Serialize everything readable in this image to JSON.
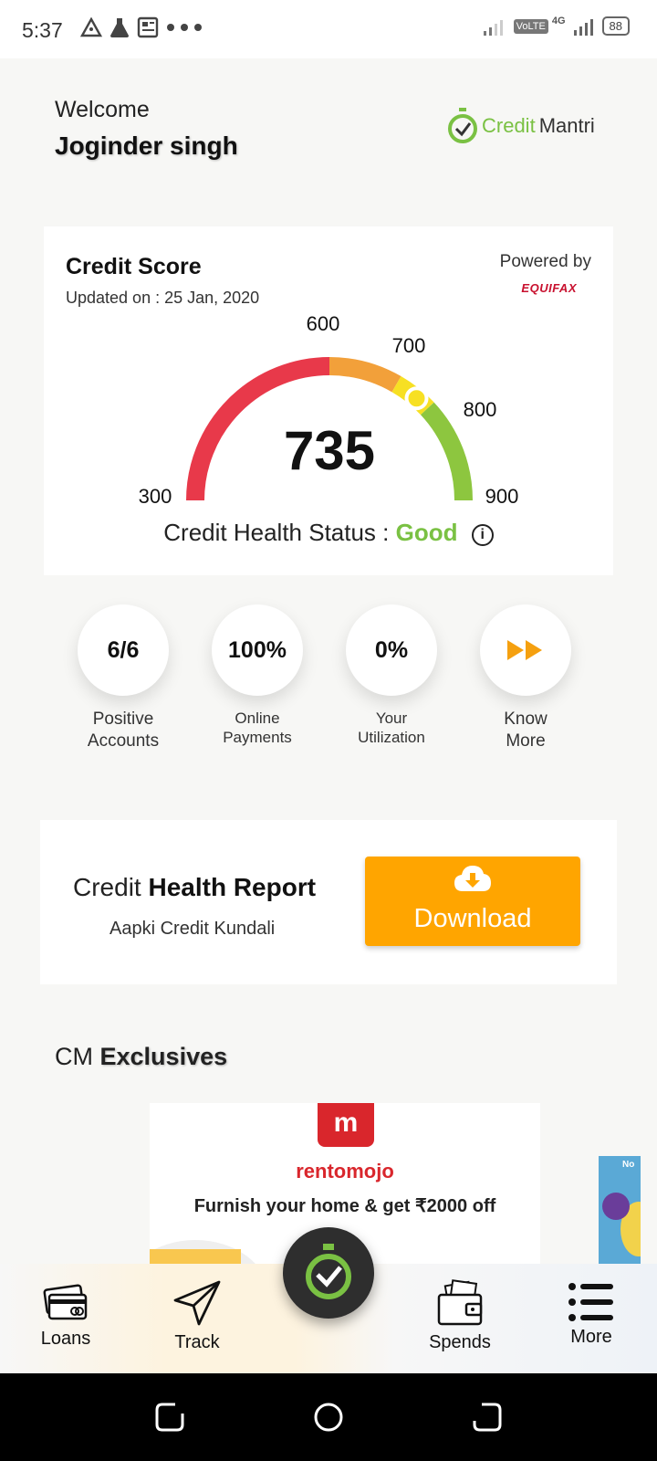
{
  "status_bar": {
    "time": "5:37",
    "battery": "88",
    "volte": "VoLTE",
    "network": "4G"
  },
  "header": {
    "welcome": "Welcome",
    "user_name": "Joginder singh",
    "logo_part1": "Credit",
    "logo_part2": "Mantri"
  },
  "score_card": {
    "title": "Credit Score",
    "updated": "Updated on : 25 Jan, 2020",
    "powered_by": "Powered by",
    "bureau": "EQUIFAX",
    "score": "735",
    "score_value": 735,
    "scale_min": 300,
    "scale_max": 900,
    "ticks": [
      "300",
      "600",
      "700",
      "800",
      "900"
    ],
    "health_label": "Credit Health Status :",
    "health_value": "Good",
    "band_colors": {
      "poor": "#e8394a",
      "fair": "#f2a03a",
      "mid": "#f7e023",
      "good": "#8dc63f"
    }
  },
  "stats": [
    {
      "value": "6/6",
      "label_line1": "Positive",
      "label_line2": "Accounts"
    },
    {
      "value": "100%",
      "label_line1": "Online",
      "label_line2": "Payments"
    },
    {
      "value": "0%",
      "label_line1": "Your",
      "label_line2": "Utilization"
    },
    {
      "icon": "fast-forward-icon",
      "label_line1": "Know",
      "label_line2": "More"
    }
  ],
  "report": {
    "title_light": "Credit",
    "title_bold": "Health Report",
    "subtitle": "Aapki Credit Kundali",
    "button_label": "Download"
  },
  "exclusives": {
    "heading_light": "CM",
    "heading_bold": "Exclusives",
    "banner": {
      "logo_text": "m",
      "brand": "rentomojo",
      "offer": "Furnish your home & get ₹2000 off"
    },
    "banner2_text": "No"
  },
  "bottom_nav": {
    "loans": "Loans",
    "track": "Track",
    "spends": "Spends",
    "more": "More"
  },
  "colors": {
    "brand_green": "#7ac143",
    "accent_orange": "#ffa500",
    "equifax_red": "#c8102e",
    "rentomojo_red": "#d9262c"
  }
}
